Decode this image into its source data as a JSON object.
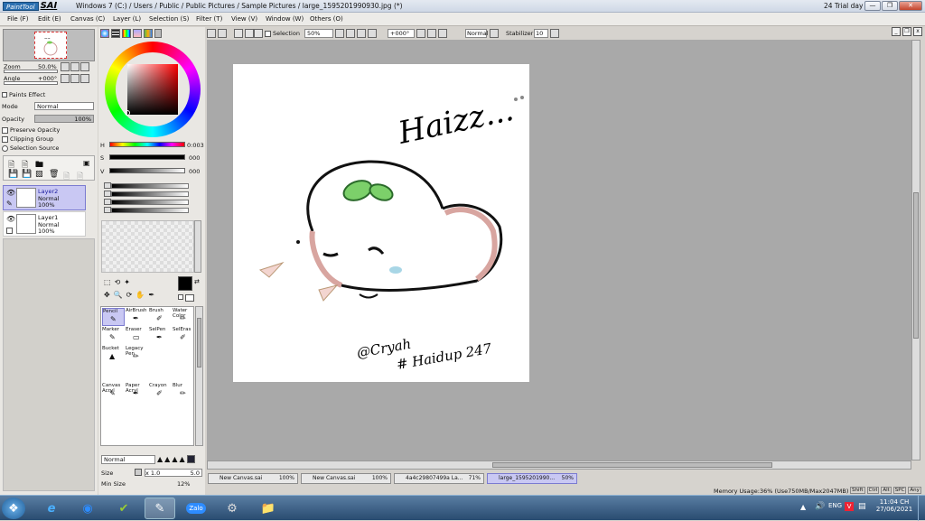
{
  "window": {
    "logo_pt": "PaintTool",
    "logo_sai": "SAI",
    "title": "Windows 7 (C:) / Users / Public / Public Pictures / Sample Pictures / large_1595201990930.jpg (*)",
    "trial": "24 Trial day"
  },
  "menu": [
    "File (F)",
    "Edit (E)",
    "Canvas (C)",
    "Layer (L)",
    "Selection (S)",
    "Filter (T)",
    "View (V)",
    "Window (W)",
    "Others (O)"
  ],
  "navigator": {
    "zoom_label": "Zoom",
    "zoom_value": "50.0%",
    "angle_label": "Angle",
    "angle_value": "+000°"
  },
  "layer_props": {
    "paint_effect": "Paints Effect",
    "mode_label": "Mode",
    "mode_value": "Normal",
    "opacity_label": "Opacity",
    "opacity_value": "100%",
    "preserve": "Preserve Opacity",
    "clipping": "Clipping Group",
    "selection": "Selection Source"
  },
  "layers": [
    {
      "name": "Layer2",
      "mode": "Normal",
      "opacity": "100%",
      "selected": true
    },
    {
      "name": "Layer1",
      "mode": "Normal",
      "opacity": "100%",
      "selected": false
    }
  ],
  "color": {
    "h_label": "H",
    "h_value": "0:003",
    "s_label": "S",
    "s_value": "000",
    "v_label": "V",
    "v_value": "000",
    "swatch_primary": "#000000",
    "swatch_secondary": "#ffffff"
  },
  "tools": [
    {
      "label": "Pencil",
      "icon": "✎",
      "selected": true
    },
    {
      "label": "AirBrush",
      "icon": "✒"
    },
    {
      "label": "Brush",
      "icon": "✐"
    },
    {
      "label": "Water Color",
      "icon": "✏"
    },
    {
      "label": "Marker",
      "icon": "✎"
    },
    {
      "label": "Eraser",
      "icon": "▭"
    },
    {
      "label": "SelPen",
      "icon": "✒"
    },
    {
      "label": "SelEras",
      "icon": "✐"
    },
    {
      "label": "Bucket",
      "icon": "▲"
    },
    {
      "label": "Legacy Pen",
      "icon": "✏"
    },
    {
      "label": "Canvas Acryl",
      "icon": "✎"
    },
    {
      "label": "Paper Acryl",
      "icon": "✒"
    },
    {
      "label": "Crayon",
      "icon": "✐"
    },
    {
      "label": "Blur",
      "icon": "✏"
    }
  ],
  "brush_panel": {
    "mode": "Normal",
    "size_label": "Size",
    "size_mult": "x 1.0",
    "size_value": "5.0",
    "min_label": "Min Size",
    "min_value": "12%"
  },
  "toolbar": {
    "selection_label": "Selection",
    "zoom_value": "50%",
    "angle_value": "+000°",
    "mode_value": "Normal",
    "stabilizer_label": "Stabilizer",
    "stabilizer_value": "10"
  },
  "doc_tabs": [
    {
      "name": "New Canvas.sai",
      "zoom": "100%"
    },
    {
      "name": "New Canvas.sai",
      "zoom": "100%"
    },
    {
      "name": "4a4c29807499a La...",
      "zoom": "71%"
    },
    {
      "name": "large_1595201990...",
      "zoom": "50%",
      "active": true
    }
  ],
  "status": {
    "memory": "Memory Usage:36% (Use750MB/Max2047MB)",
    "keys": [
      "Shift",
      "Ctrl",
      "Alt",
      "SPC",
      "Any"
    ]
  },
  "artwork": {
    "text_top": "Haizz...",
    "signature": "@Cryah",
    "hashtag": "# Haidup 247"
  },
  "taskbar": {
    "apps": [
      "start-icon",
      "ie-icon",
      "zoom-icon",
      "files-icon",
      "sai-icon",
      "zalo-icon",
      "browser-icon",
      "folder-icon"
    ],
    "zalo_label": "Zalo",
    "tray_lang": "ENG",
    "time": "11:04 CH",
    "date": "27/06/2021"
  }
}
